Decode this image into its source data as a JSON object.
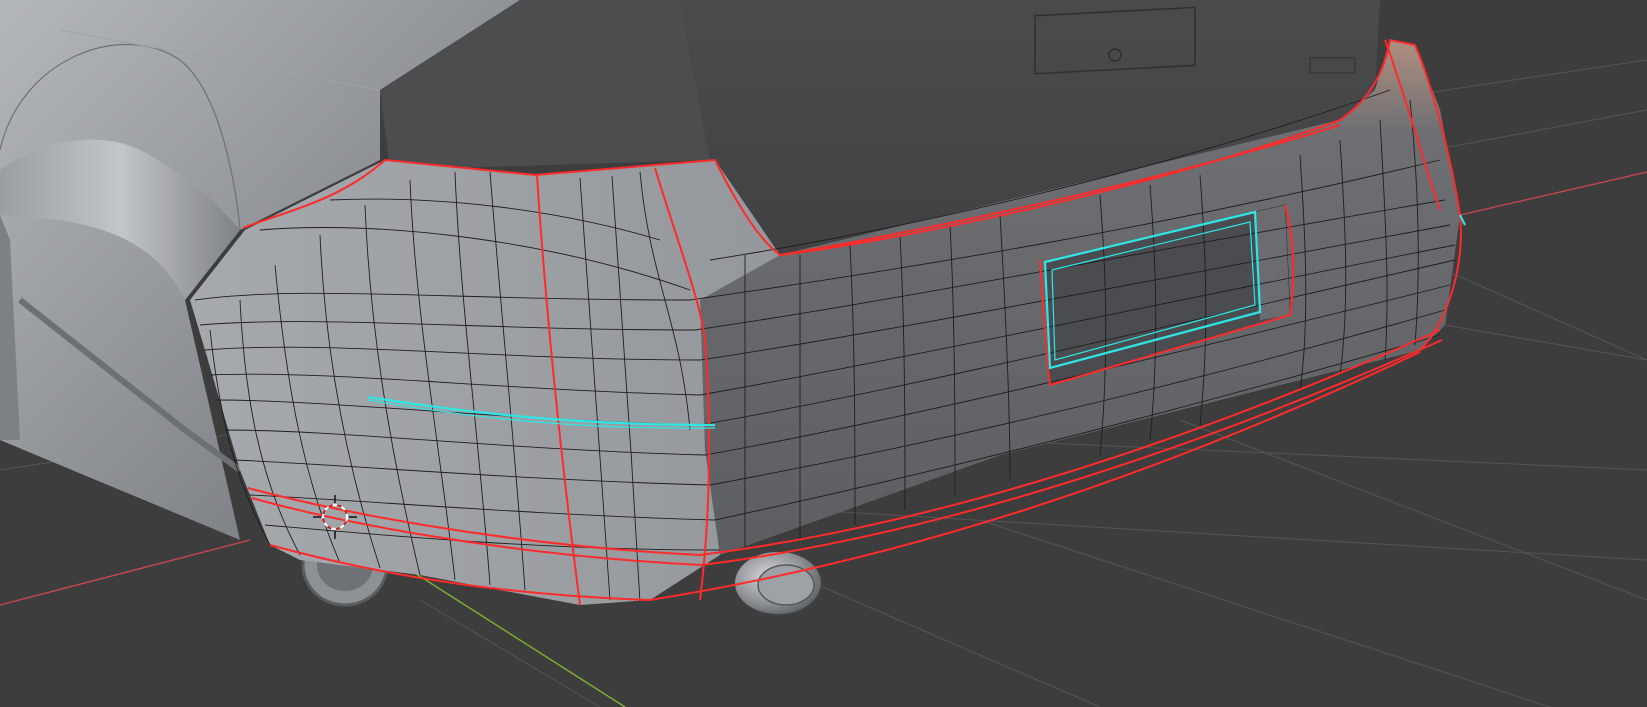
{
  "app": {
    "name": "3D Viewport",
    "mode": "edit-mode"
  },
  "scene": {
    "object": "car-rear-bumper-mesh",
    "background_color": "#3d3d3d",
    "grid_color": "#555555",
    "x_axis_color": "#c8474f",
    "y_axis_color": "#7fb12d",
    "mesh_color": "#8a8e93",
    "wire_color": "#1e1e1e",
    "seam_color": "#ff2a2a",
    "selected_edge_color": "#2ee6e6"
  },
  "overlays": {
    "cursor_icon": "3d-cursor-icon",
    "seam_edges": "uv-seams",
    "selected_edges": "selected-edge-loops"
  }
}
